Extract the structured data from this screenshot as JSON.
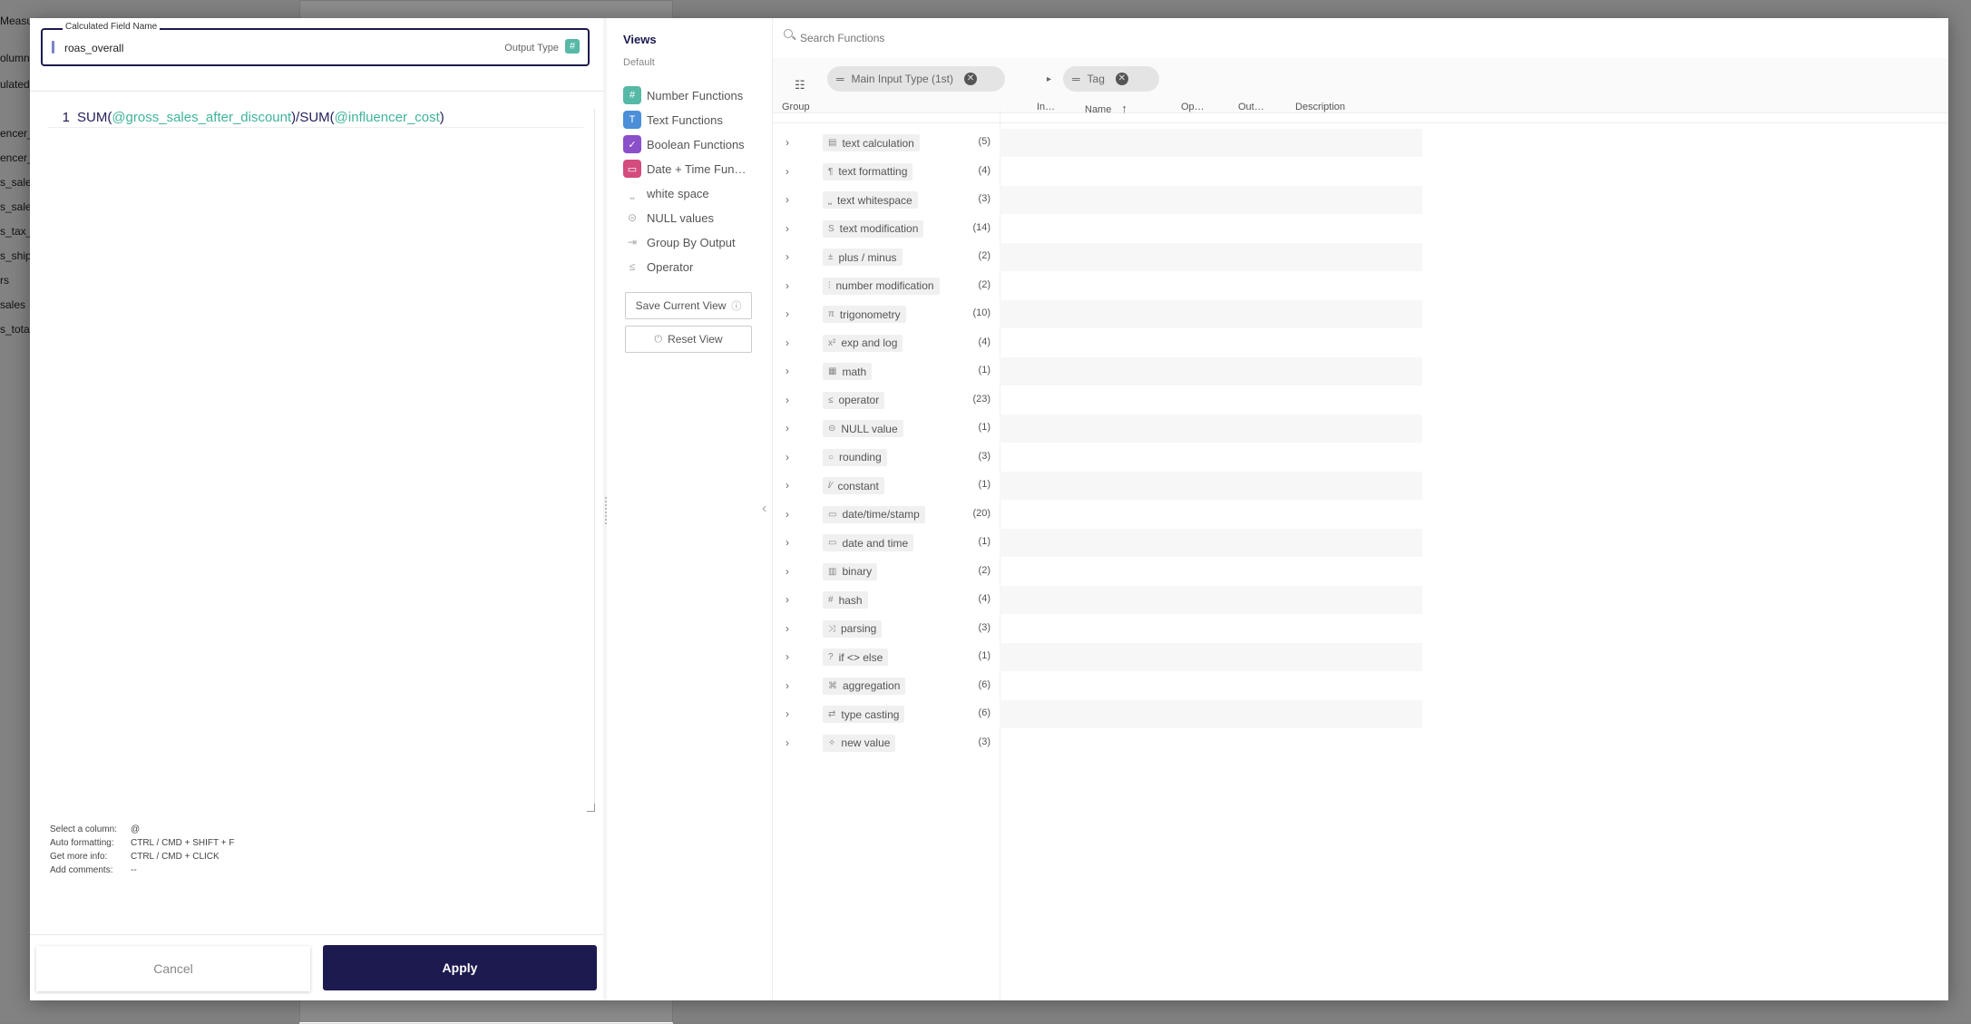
{
  "background": {
    "left_items": [
      "Measu…",
      "olumns",
      "ulated",
      "encer_",
      "encer_",
      "s_sale",
      "s_sale",
      "s_tax_a",
      "s_shipp",
      "rs",
      "sales",
      "s_total"
    ]
  },
  "editor": {
    "field_legend": "Calculated Field Name",
    "field_value": "roas_overall",
    "output_type_label": "Output Type",
    "output_type_icon": "hash-icon",
    "line_number": "1",
    "code": {
      "fn1": "SUM(",
      "col1": "@gross_sales_after_discount",
      "mid": ")/SUM(",
      "col2": "@influencer_cost",
      "end": ")"
    },
    "shortcuts": [
      {
        "label": "Select a column:",
        "key": "@"
      },
      {
        "label": "Auto formatting:",
        "key": "CTRL / CMD + SHIFT + F"
      },
      {
        "label": "Get more info:",
        "key": "CTRL / CMD + CLICK"
      },
      {
        "label": "Add comments:",
        "key": "--"
      }
    ],
    "cancel_label": "Cancel",
    "apply_label": "Apply"
  },
  "views": {
    "title": "Views",
    "subtitle": "Default",
    "items": [
      {
        "label": "Number Functions",
        "icon": "#",
        "color": "#56b8a6"
      },
      {
        "label": "Text Functions",
        "icon": "T",
        "color": "#4a8fd8"
      },
      {
        "label": "Boolean Functions",
        "icon": "✓",
        "color": "#8a4fc9"
      },
      {
        "label": "Date + Time Fun…",
        "icon": "▭",
        "color": "#d44b7e"
      },
      {
        "label": "white space",
        "icon": "⎵",
        "color": ""
      },
      {
        "label": "NULL values",
        "icon": "⊝",
        "color": ""
      },
      {
        "label": "Group By Output",
        "icon": "⇥",
        "color": ""
      },
      {
        "label": "Operator",
        "icon": "≤",
        "color": ""
      }
    ],
    "save_label": "Save Current View",
    "reset_label": "Reset View"
  },
  "functions": {
    "search_placeholder": "Search Functions",
    "chips": [
      {
        "label": "Main Input Type (1st)"
      },
      {
        "label": "Tag"
      }
    ],
    "columns": {
      "group": "Group",
      "input": "In…",
      "name": "Name",
      "name_sort": "↑",
      "op": "Op…",
      "out": "Out…",
      "description": "Description"
    },
    "groups": [
      {
        "icon": "▤",
        "label": "text calculation",
        "count": "(5)"
      },
      {
        "icon": "¶",
        "label": "text formatting",
        "count": "(4)"
      },
      {
        "icon": "⎵",
        "label": "text whitespace",
        "count": "(3)"
      },
      {
        "icon": "S",
        "label": "text modification",
        "count": "(14)"
      },
      {
        "icon": "±",
        "label": "plus / minus",
        "count": "(2)"
      },
      {
        "icon": "⫶",
        "label": "number modification",
        "count": "(2)"
      },
      {
        "icon": "π",
        "label": "trigonometry",
        "count": "(10)"
      },
      {
        "icon": "x²",
        "label": "exp and log",
        "count": "(4)"
      },
      {
        "icon": "▦",
        "label": "math",
        "count": "(1)"
      },
      {
        "icon": "≤",
        "label": "operator",
        "count": "(23)"
      },
      {
        "icon": "⊝",
        "label": "NULL value",
        "count": "(1)"
      },
      {
        "icon": "○",
        "label": "rounding",
        "count": "(3)"
      },
      {
        "icon": "/∕",
        "label": "constant",
        "count": "(1)"
      },
      {
        "icon": "▭",
        "label": "date/time/stamp",
        "count": "(20)"
      },
      {
        "icon": "▭",
        "label": "date and time",
        "count": "(1)"
      },
      {
        "icon": "▥",
        "label": "binary",
        "count": "(2)"
      },
      {
        "icon": "#",
        "label": "hash",
        "count": "(4)"
      },
      {
        "icon": "⤨",
        "label": "parsing",
        "count": "(3)"
      },
      {
        "icon": "?",
        "label": "if <> else",
        "count": "(1)"
      },
      {
        "icon": "⌘",
        "label": "aggregation",
        "count": "(6)"
      },
      {
        "icon": "⇄",
        "label": "type casting",
        "count": "(6)"
      },
      {
        "icon": "✧",
        "label": "new value",
        "count": "(3)"
      }
    ]
  }
}
